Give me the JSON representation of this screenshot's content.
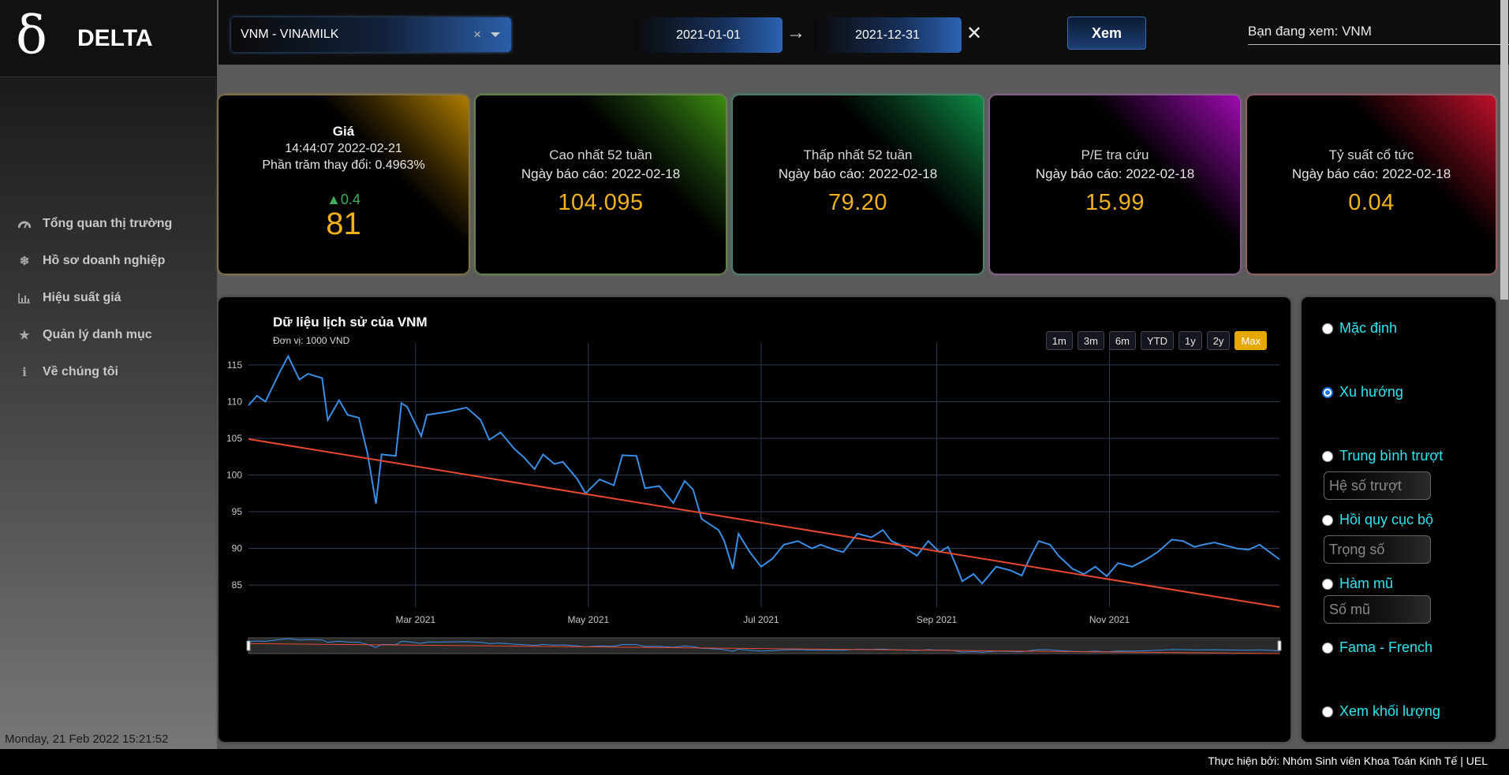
{
  "brand": {
    "logo": "δ",
    "name": "DELTA"
  },
  "sidebar": {
    "items": [
      {
        "label": "Tổng quan thị trường",
        "icon": "dashboard-icon"
      },
      {
        "label": "Hồ sơ doanh nghiệp",
        "icon": "snowflake-icon"
      },
      {
        "label": "Hiệu suất giá",
        "icon": "bar-chart-icon"
      },
      {
        "label": "Quản lý danh mục",
        "icon": "star-icon"
      },
      {
        "label": "Về chúng tôi",
        "icon": "info-icon"
      }
    ],
    "clock": "Monday, 21 Feb 2022 15:21:52"
  },
  "topbar": {
    "ticker": "VNM - VINAMILK",
    "ticker_clear": "×",
    "date_start": "2021-01-01",
    "date_arrow": "→",
    "date_end": "2021-12-31",
    "date_clear": "✕",
    "view_button": "Xem",
    "viewing": "Bạn đang xem: VNM"
  },
  "cards": {
    "price": {
      "title": "Giá",
      "time": "14:44:07 2022-02-21",
      "change_pct": "Phần trăm thay đổi: 0.4963%",
      "delta": "▲0.4",
      "value": "81"
    },
    "high52": {
      "title": "Cao nhất 52 tuần",
      "report": "Ngày báo cáo: 2022-02-18",
      "value": "104.095"
    },
    "low52": {
      "title": "Thấp nhất 52 tuần",
      "report": "Ngày báo cáo: 2022-02-18",
      "value": "79.20"
    },
    "pe": {
      "title": "P/E tra cứu",
      "report": "Ngày báo cáo: 2022-02-18",
      "value": "15.99"
    },
    "dividend": {
      "title": "Tỷ suất cổ tức",
      "report": "Ngày báo cáo: 2022-02-18",
      "value": "0.04"
    }
  },
  "chart": {
    "title": "Dữ liệu lịch sử của VNM",
    "unit": "Đơn vị: 1000 VND",
    "range_buttons": [
      "1m",
      "3m",
      "6m",
      "YTD",
      "1y",
      "2y",
      "Max"
    ],
    "active_range": "Max"
  },
  "chart_data": {
    "type": "line",
    "x_start": "2021-01-01",
    "x_end": "2021-12-31",
    "xticks": [
      {
        "date": "2021-03-01",
        "label": "Mar 2021"
      },
      {
        "date": "2021-05-01",
        "label": "May 2021"
      },
      {
        "date": "2021-07-01",
        "label": "Jul 2021"
      },
      {
        "date": "2021-09-01",
        "label": "Sep 2021"
      },
      {
        "date": "2021-11-01",
        "label": "Nov 2021"
      }
    ],
    "yticks": [
      85,
      90,
      95,
      100,
      105,
      110,
      115
    ],
    "ylim": [
      82,
      118
    ],
    "grid": true,
    "colors": {
      "price": "#3a8ee6",
      "trend": "#e8492e"
    },
    "series": [
      {
        "points": [
          [
            "2021-01-01",
            109.5
          ],
          [
            "2021-01-04",
            110.8
          ],
          [
            "2021-01-07",
            110.0
          ],
          [
            "2021-01-12",
            114.0
          ],
          [
            "2021-01-15",
            116.2
          ],
          [
            "2021-01-19",
            113.0
          ],
          [
            "2021-01-22",
            113.8
          ],
          [
            "2021-01-27",
            113.2
          ],
          [
            "2021-01-29",
            107.5
          ],
          [
            "2021-02-02",
            110.2
          ],
          [
            "2021-02-05",
            108.2
          ],
          [
            "2021-02-09",
            107.8
          ],
          [
            "2021-02-12",
            103.0
          ],
          [
            "2021-02-15",
            96.1
          ],
          [
            "2021-02-17",
            102.8
          ],
          [
            "2021-02-22",
            102.6
          ],
          [
            "2021-02-24",
            109.8
          ],
          [
            "2021-02-26",
            109.3
          ],
          [
            "2021-03-03",
            105.3
          ],
          [
            "2021-03-05",
            108.2
          ],
          [
            "2021-03-12",
            108.6
          ],
          [
            "2021-03-19",
            109.2
          ],
          [
            "2021-03-24",
            107.5
          ],
          [
            "2021-03-27",
            104.8
          ],
          [
            "2021-03-31",
            105.8
          ],
          [
            "2021-04-05",
            103.5
          ],
          [
            "2021-04-08",
            102.5
          ],
          [
            "2021-04-12",
            100.8
          ],
          [
            "2021-04-15",
            102.8
          ],
          [
            "2021-04-19",
            101.5
          ],
          [
            "2021-04-22",
            101.8
          ],
          [
            "2021-04-27",
            99.5
          ],
          [
            "2021-04-30",
            97.5
          ],
          [
            "2021-05-05",
            99.4
          ],
          [
            "2021-05-10",
            98.6
          ],
          [
            "2021-05-13",
            102.7
          ],
          [
            "2021-05-18",
            102.6
          ],
          [
            "2021-05-21",
            98.2
          ],
          [
            "2021-05-26",
            98.5
          ],
          [
            "2021-05-31",
            96.2
          ],
          [
            "2021-06-04",
            99.2
          ],
          [
            "2021-06-07",
            98.0
          ],
          [
            "2021-06-10",
            94.0
          ],
          [
            "2021-06-16",
            92.5
          ],
          [
            "2021-06-18",
            91.0
          ],
          [
            "2021-06-21",
            87.2
          ],
          [
            "2021-06-23",
            92.0
          ],
          [
            "2021-06-27",
            89.5
          ],
          [
            "2021-07-01",
            87.5
          ],
          [
            "2021-07-05",
            88.6
          ],
          [
            "2021-07-09",
            90.5
          ],
          [
            "2021-07-14",
            91.0
          ],
          [
            "2021-07-19",
            90.0
          ],
          [
            "2021-07-22",
            90.5
          ],
          [
            "2021-07-27",
            89.8
          ],
          [
            "2021-07-30",
            89.5
          ],
          [
            "2021-08-04",
            92.0
          ],
          [
            "2021-08-09",
            91.5
          ],
          [
            "2021-08-13",
            92.5
          ],
          [
            "2021-08-16",
            91.0
          ],
          [
            "2021-08-19",
            90.5
          ],
          [
            "2021-08-25",
            89.0
          ],
          [
            "2021-08-29",
            91.0
          ],
          [
            "2021-09-02",
            89.5
          ],
          [
            "2021-09-05",
            90.2
          ],
          [
            "2021-09-08",
            87.5
          ],
          [
            "2021-09-10",
            85.5
          ],
          [
            "2021-09-14",
            86.5
          ],
          [
            "2021-09-17",
            85.2
          ],
          [
            "2021-09-22",
            87.5
          ],
          [
            "2021-09-27",
            87.0
          ],
          [
            "2021-10-01",
            86.3
          ],
          [
            "2021-10-04",
            88.8
          ],
          [
            "2021-10-07",
            91.0
          ],
          [
            "2021-10-11",
            90.5
          ],
          [
            "2021-10-14",
            89.0
          ],
          [
            "2021-10-19",
            87.2
          ],
          [
            "2021-10-23",
            86.5
          ],
          [
            "2021-10-27",
            87.5
          ],
          [
            "2021-10-31",
            86.2
          ],
          [
            "2021-11-04",
            88.0
          ],
          [
            "2021-11-09",
            87.5
          ],
          [
            "2021-11-14",
            88.5
          ],
          [
            "2021-11-18",
            89.5
          ],
          [
            "2021-11-23",
            91.2
          ],
          [
            "2021-11-27",
            91.0
          ],
          [
            "2021-12-01",
            90.2
          ],
          [
            "2021-12-04",
            90.5
          ],
          [
            "2021-12-08",
            90.8
          ],
          [
            "2021-12-13",
            90.3
          ],
          [
            "2021-12-16",
            90.0
          ],
          [
            "2021-12-20",
            89.8
          ],
          [
            "2021-12-24",
            90.5
          ],
          [
            "2021-12-31",
            88.5
          ]
        ]
      },
      {
        "points": [
          [
            "2021-01-01",
            104.9
          ],
          [
            "2021-12-31",
            82.0
          ]
        ]
      }
    ]
  },
  "methods": {
    "options": [
      "Mặc định",
      "Xu hướng",
      "Trung bình trượt",
      "Hồi quy cục bộ",
      "Hàm mũ",
      "Fama - French",
      "Xem khối lượng"
    ],
    "selected": "Xu hướng",
    "params": {
      "moving_avg": "Hệ số trượt",
      "local_reg": "Trọng số",
      "exponent": "Số mũ"
    }
  },
  "footer": {
    "credit": "Thực hiện bởi: Nhóm Sinh viên Khoa Toán Kinh Tế | UEL"
  }
}
